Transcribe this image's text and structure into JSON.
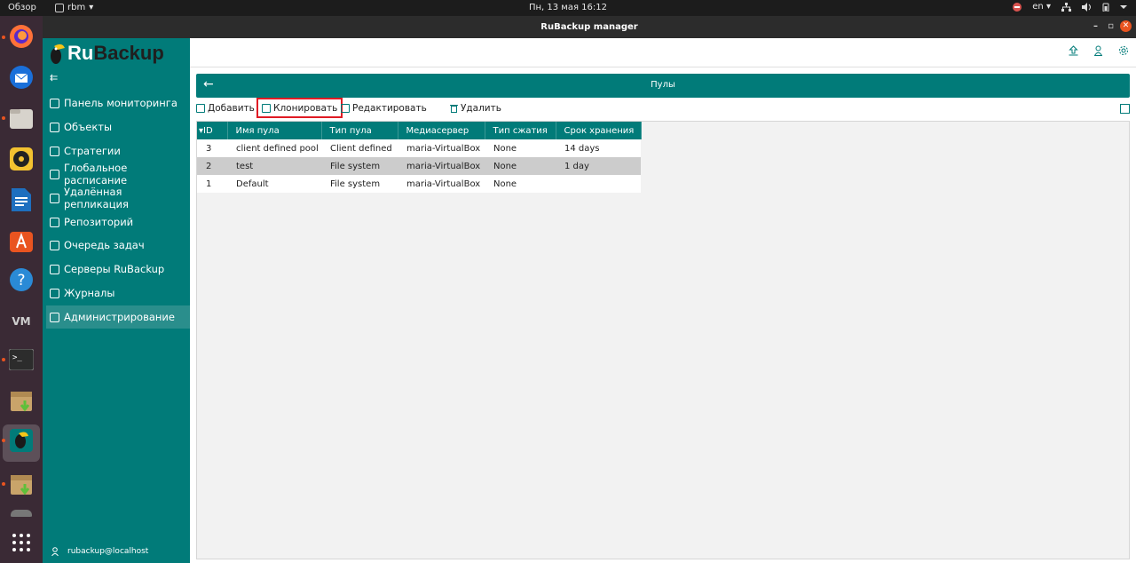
{
  "topbar": {
    "overview": "Обзор",
    "app_name": "rbm",
    "app_arrow": "▾",
    "clock": "Пн, 13 мая  16:12",
    "language": "en",
    "lang_arrow": "▾"
  },
  "window": {
    "title": "RuBackup manager",
    "minimize": "–",
    "maximize": "▫",
    "close": "✕"
  },
  "sidebar": {
    "logo_ru": "Ru",
    "logo_backup": "Backup",
    "collapse": "⇇",
    "items": [
      {
        "label": "Панель мониторинга",
        "icon": "dashboard-icon"
      },
      {
        "label": "Объекты",
        "icon": "monitor-icon"
      },
      {
        "label": "Стратегии",
        "icon": "list-icon"
      },
      {
        "label": "Глобальное расписание",
        "icon": "calendar-icon"
      },
      {
        "label": "Удалённая репликация",
        "icon": "replication-icon"
      },
      {
        "label": "Репозиторий",
        "icon": "database-icon"
      },
      {
        "label": "Очередь задач",
        "icon": "tasks-icon"
      },
      {
        "label": "Серверы RuBackup",
        "icon": "server-icon"
      },
      {
        "label": "Журналы",
        "icon": "log-icon"
      },
      {
        "label": "Администрирование",
        "icon": "admin-icon"
      }
    ],
    "active_index": 9,
    "user": "rubackup@localhost"
  },
  "page": {
    "title": "Пулы",
    "back": "←"
  },
  "toolbar": {
    "add": "Добавить",
    "clone": "Клонировать",
    "edit": "Редактировать",
    "delete": "Удалить"
  },
  "table": {
    "sort_marker": "▾",
    "columns": [
      "ID",
      "Имя пула",
      "Тип пула",
      "Медиасервер",
      "Тип сжатия",
      "Срок хранения"
    ],
    "rows": [
      {
        "id": "3",
        "name": "client defined pool",
        "type": "Client defined",
        "media": "maria-VirtualBox",
        "compression": "None",
        "retention": "14 days"
      },
      {
        "id": "2",
        "name": "test",
        "type": "File system",
        "media": "maria-VirtualBox",
        "compression": "None",
        "retention": "1 day"
      },
      {
        "id": "1",
        "name": "Default",
        "type": "File system",
        "media": "maria-VirtualBox",
        "compression": "None",
        "retention": ""
      }
    ],
    "selected_row": 1
  },
  "colors": {
    "accent": "#017b79",
    "highlight_border": "#e01b24",
    "dock_bg": "#3a2a35",
    "ubuntu_orange": "#e95420"
  }
}
